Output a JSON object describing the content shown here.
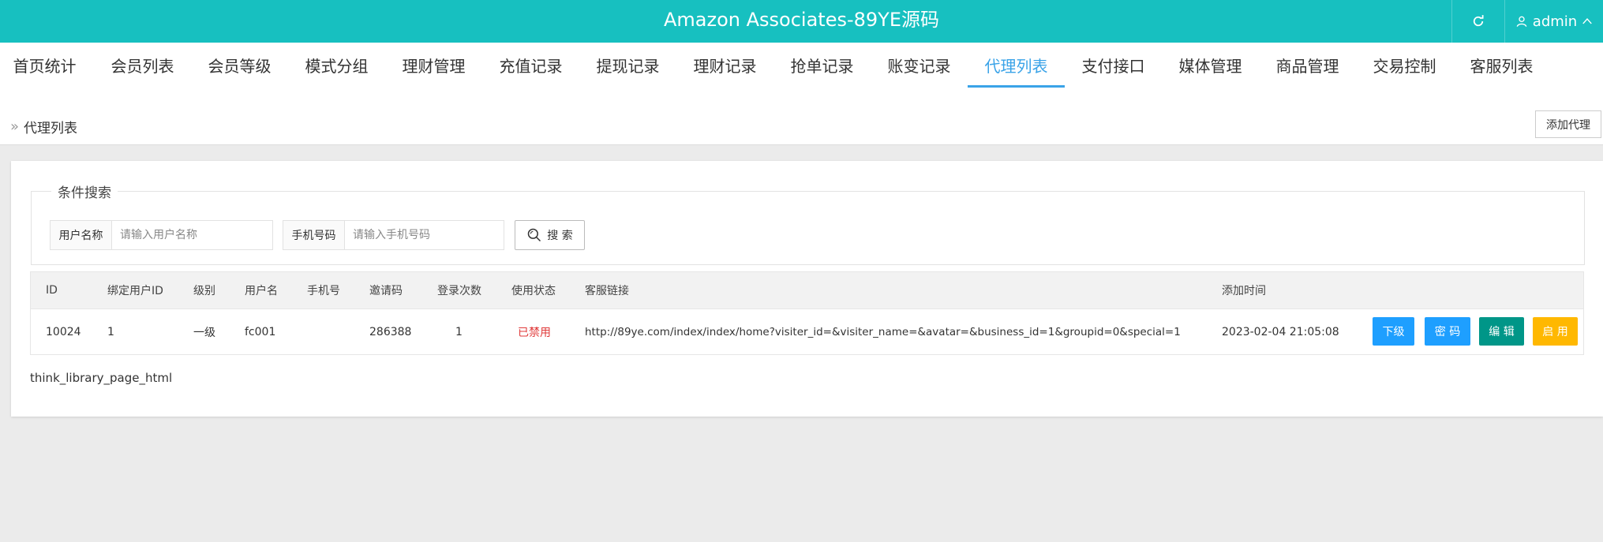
{
  "header": {
    "title": "Amazon Associates-89YE源码",
    "refresh_icon": "refresh-icon",
    "user_icon": "user-icon",
    "username": "admin",
    "chevron_icon": "chevron-up-icon"
  },
  "nav": {
    "items": [
      {
        "label": "首页统计"
      },
      {
        "label": "会员列表"
      },
      {
        "label": "会员等级"
      },
      {
        "label": "模式分组"
      },
      {
        "label": "理财管理"
      },
      {
        "label": "充值记录"
      },
      {
        "label": "提现记录"
      },
      {
        "label": "理财记录"
      },
      {
        "label": "抢单记录"
      },
      {
        "label": "账变记录"
      },
      {
        "label": "代理列表"
      },
      {
        "label": "支付接口"
      },
      {
        "label": "媒体管理"
      },
      {
        "label": "商品管理"
      },
      {
        "label": "交易控制"
      },
      {
        "label": "客服列表"
      }
    ],
    "active_index": 10,
    "active_color": "#3aa3e8"
  },
  "breadcrumb": {
    "separator": "»",
    "current": "代理列表"
  },
  "toolbar": {
    "add_label": "添加代理"
  },
  "search": {
    "legend": "条件搜索",
    "username": {
      "label": "用户名称",
      "placeholder": "请输入用户名称",
      "value": ""
    },
    "phone": {
      "label": "手机号码",
      "placeholder": "请输入手机号码",
      "value": ""
    },
    "search_label": "搜 索",
    "search_icon": "search-icon"
  },
  "table": {
    "headers": [
      "ID",
      "绑定用户ID",
      "级别",
      "用户名",
      "手机号",
      "邀请码",
      "登录次数",
      "使用状态",
      "客服链接",
      "添加时间"
    ],
    "rows": [
      {
        "id": "10024",
        "bind_user_id": "1",
        "level": "一级",
        "username": "fc001",
        "phone": "",
        "invite_code": "286388",
        "login_count": "1",
        "status": "已禁用",
        "service_link": "http://89ye.com/index/index/home?visiter_id=&visiter_name=&avatar=&business_id=1&groupid=0&special=1",
        "add_time": "2023-02-04 21:05:08",
        "actions": {
          "subordinate": "下级",
          "password": "密 码",
          "edit": "编 辑",
          "enable": "启 用"
        }
      }
    ]
  },
  "pager": {
    "text": "think_library_page_html"
  },
  "colors": {
    "header_bg": "#17c0c0",
    "status_disabled": "#e03a3a",
    "btn_blue": "#1e9fff",
    "btn_green": "#009688",
    "btn_yellow": "#ffb800"
  }
}
